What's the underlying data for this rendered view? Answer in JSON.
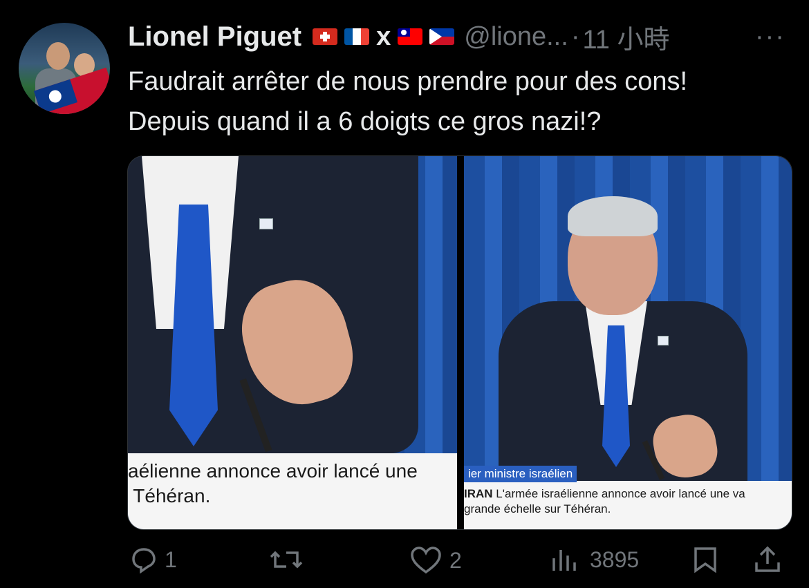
{
  "tweet": {
    "author_name": "Lionel Piguet",
    "flags": [
      "swiss-flag-icon",
      "france-flag-icon",
      "taiwan-flag-icon",
      "philippines-flag-icon"
    ],
    "flag_separator": "x",
    "handle": "@lione...",
    "time_separator": "·",
    "time": "11 小時",
    "more": "···",
    "text_line1": "Faudrait arrêter de nous prendre pour des cons!",
    "text_line2": "Depuis quand il a 6 doigts ce gros nazi!?"
  },
  "media": {
    "left_ticker_line1": "aélienne annonce avoir lancé une",
    "left_ticker_line2": " Téhéran.",
    "right_ticker_label": "ier ministre israélien",
    "right_ticker_topic": "IRAN",
    "right_ticker_line1": " L'armée israélienne annonce avoir lancé une va",
    "right_ticker_line2": "grande échelle sur Téhéran."
  },
  "actions": {
    "replies": "1",
    "retweets": "",
    "likes": "2",
    "views": "3895"
  },
  "colors": {
    "background": "#000000",
    "text": "#e7e9ea",
    "muted": "#71767b"
  }
}
